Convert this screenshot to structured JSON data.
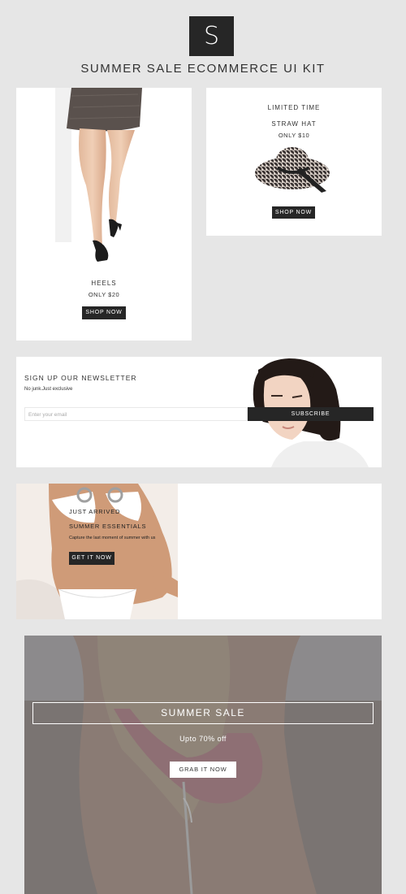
{
  "header": {
    "logo_letter": "S",
    "title": "SUMMER SALE ECOMMERCE UI KIT"
  },
  "heels": {
    "name": "HEELS",
    "price": "ONLY $20",
    "button": "SHOP NOW"
  },
  "hat": {
    "label": "LIMITED TIME",
    "name": "STRAW HAT",
    "price": "ONLY $10",
    "button": "SHOP NOW"
  },
  "newsletter": {
    "title": "SIGN UP OUR NEWSLETTER",
    "subtitle": "No junk.Just exclusive",
    "email_placeholder": "Enter your email",
    "button": "SUBSCRIBE"
  },
  "arrived": {
    "label": "JUST ARRIVED",
    "title": "SUMMER ESSENTIALS",
    "text": "Capture the last moment of summer with us",
    "button": "GET IT NOW"
  },
  "hero": {
    "title": "SUMMER SALE",
    "subtitle": "Upto 70% off",
    "button": "GRAB IT NOW"
  },
  "colors": {
    "background": "#e6e6e6",
    "dark": "#262626",
    "card": "#ffffff"
  }
}
